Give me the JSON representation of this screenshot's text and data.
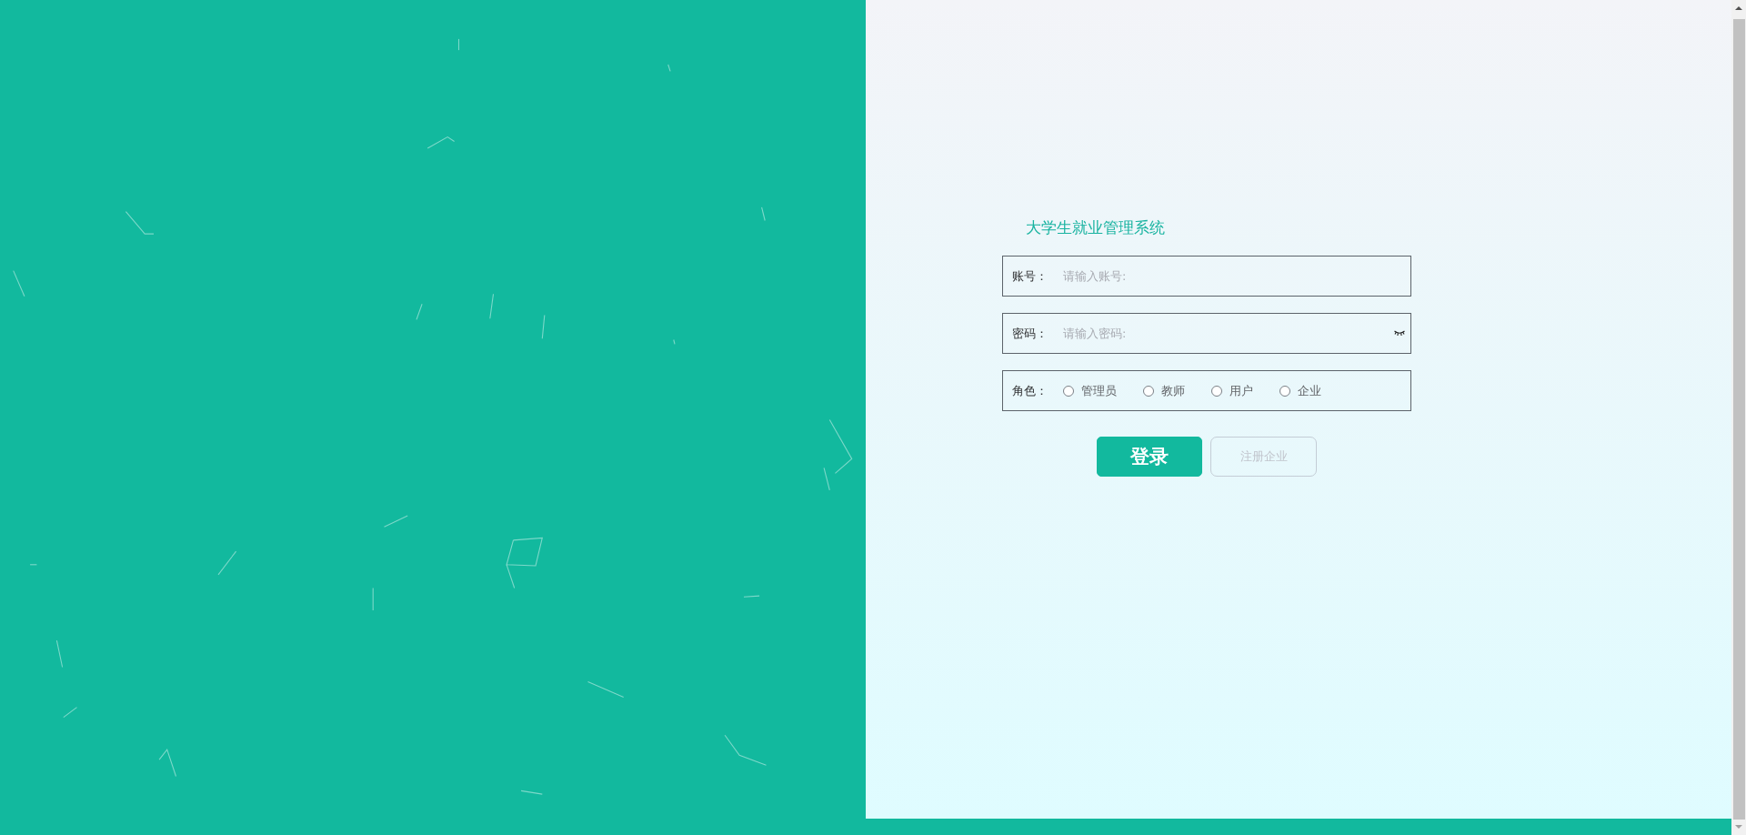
{
  "title": "大学生就业管理系统",
  "fields": [
    {
      "kind": "text",
      "label": "账号：",
      "placeholder": "请输入账号:"
    },
    {
      "kind": "password",
      "label": "密码：",
      "placeholder": "请输入密码:"
    }
  ],
  "role": {
    "label": "角色：",
    "options": [
      {
        "label": "管理员",
        "selected": false
      },
      {
        "label": "教师",
        "selected": false
      },
      {
        "label": "用户",
        "selected": false
      },
      {
        "label": "企业",
        "selected": false
      }
    ]
  },
  "buttons": [
    {
      "kind": "primary",
      "label": "登录",
      "disabled": false
    },
    {
      "kind": "plain",
      "label": "注册企业",
      "disabled": true
    }
  ]
}
